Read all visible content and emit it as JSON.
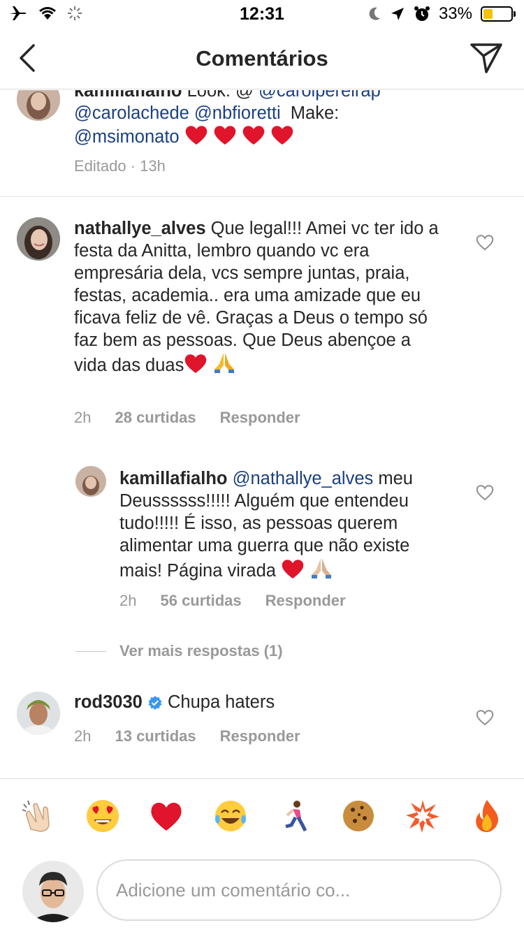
{
  "status_bar": {
    "time": "12:31",
    "battery_percent": "33%",
    "battery_level": 0.33
  },
  "nav": {
    "title": "Comentários"
  },
  "comments": [
    {
      "username": "kamillafialho",
      "text_parts": [
        "Look: @",
        "@carolpereirap",
        "@carolachede",
        "@nbfioretti",
        "Make:",
        "@msimonato"
      ],
      "meta": "Editado · 13h"
    },
    {
      "username": "nathallye_alves",
      "text": "Que legal!!! Amei vc ter ido a festa da Anitta, lembro quando vc era empresária dela, vcs sempre juntas, praia, festas, academia.. era uma amizade que eu ficava feliz de vê. Graças a Deus o tempo só faz bem as pessoas. Que Deus abençoe a vida das duas",
      "time": "2h",
      "likes": "28 curtidas",
      "reply": "Responder",
      "reply_item": {
        "username": "kamillafialho",
        "mention": "@nathallye_alves",
        "text": "meu Deussssss!!!!! Alguém que entendeu tudo!!!!! É isso, as pessoas querem alimentar uma guerra que não existe mais! Página virada",
        "time": "2h",
        "likes": "56 curtidas",
        "reply": "Responder"
      },
      "more_replies": "Ver mais respostas (1)"
    },
    {
      "username": "rod3030",
      "text": "Chupa haters",
      "time": "2h",
      "likes": "13 curtidas",
      "reply": "Responder"
    }
  ],
  "emoji_bar": [
    "clapping-hands",
    "heart-eyes",
    "red-heart",
    "tears-of-joy",
    "runner",
    "cookie",
    "collision",
    "fire"
  ],
  "composer": {
    "placeholder": "Adicione um comentário co..."
  },
  "colors": {
    "mention": "#1b3f82",
    "meta": "#999999",
    "text": "#262626",
    "heart": "#e0142a"
  }
}
